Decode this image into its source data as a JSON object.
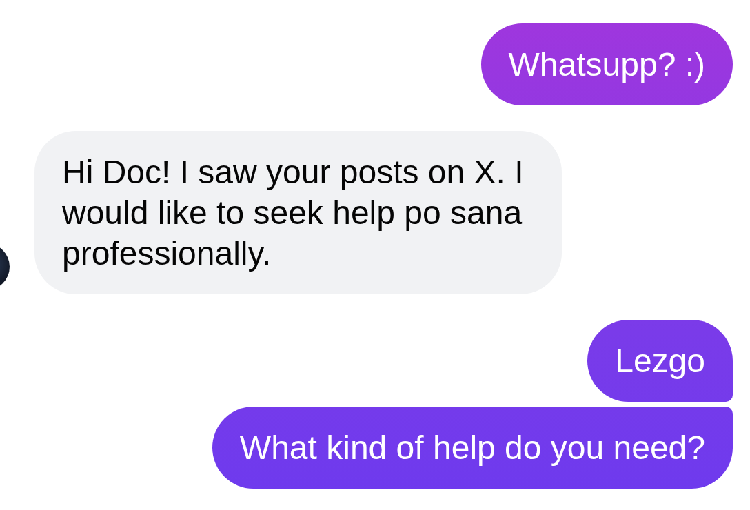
{
  "messages": [
    {
      "kind": "sent",
      "text": "Whatsupp? :)"
    },
    {
      "kind": "received",
      "text": "Hi Doc! I saw your posts on X. I would like to seek help po sana professionally.",
      "avatar": true
    },
    {
      "kind": "sent",
      "text": "Lezgo"
    },
    {
      "kind": "sent",
      "text": "What kind of help do you need?"
    }
  ]
}
